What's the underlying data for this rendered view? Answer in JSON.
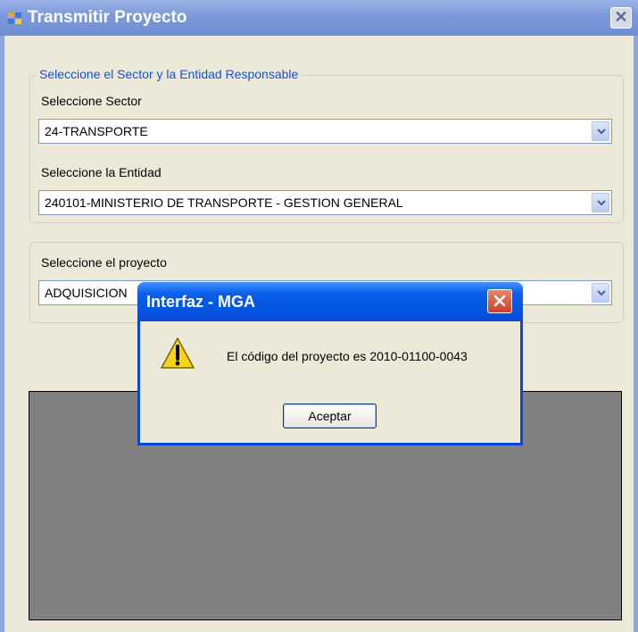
{
  "window": {
    "title": "Transmitir Proyecto",
    "close_glyph": "✕"
  },
  "group_sector": {
    "legend": "Seleccione el Sector y la Entidad Responsable",
    "sector_label": "Seleccione Sector",
    "sector_value": "24-TRANSPORTE",
    "entity_label": "Seleccione la Entidad",
    "entity_value": "240101-MINISTERIO DE TRANSPORTE - GESTION GENERAL"
  },
  "group_project": {
    "project_label": "Seleccione el proyecto",
    "project_value": "ADQUISICION"
  },
  "dialog": {
    "title": "Interfaz - MGA",
    "message": "El código del proyecto es 2010-01100-0043",
    "ok_label": "Aceptar"
  },
  "colors": {
    "accent": "#0a47d8",
    "legend_text": "#1550d6",
    "panel": "#808080"
  },
  "icons": {
    "app": "app-icon",
    "dropdown": "chevron-down-icon",
    "warning": "warning-icon",
    "close": "close-icon"
  }
}
